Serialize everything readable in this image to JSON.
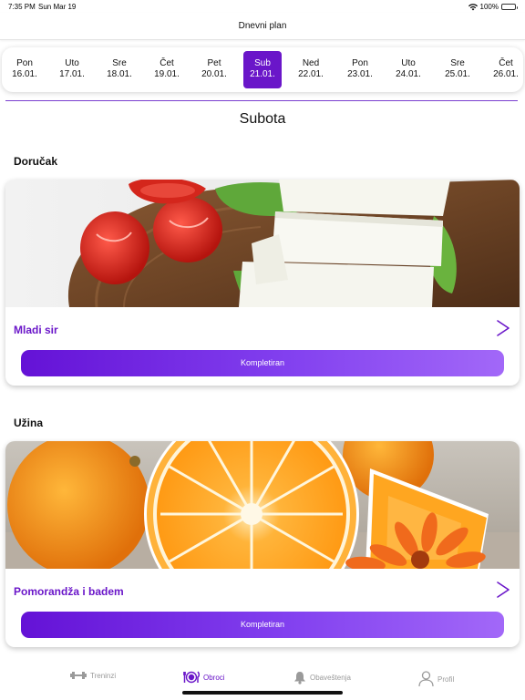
{
  "status": {
    "time": "7:35 PM",
    "date": "Sun Mar 19",
    "battery": "100%",
    "battery_level": 1.0
  },
  "nav": {
    "title": "Dnevni plan"
  },
  "days": [
    {
      "name": "Pon",
      "date": "16.01."
    },
    {
      "name": "Uto",
      "date": "17.01."
    },
    {
      "name": "Sre",
      "date": "18.01."
    },
    {
      "name": "Čet",
      "date": "19.01."
    },
    {
      "name": "Pet",
      "date": "20.01."
    },
    {
      "name": "Sub",
      "date": "21.01.",
      "selected": true
    },
    {
      "name": "Ned",
      "date": "22.01."
    },
    {
      "name": "Pon",
      "date": "23.01."
    },
    {
      "name": "Uto",
      "date": "24.01."
    },
    {
      "name": "Sre",
      "date": "25.01."
    },
    {
      "name": "Čet",
      "date": "26.01."
    }
  ],
  "selected_day_title": "Subota",
  "meals": [
    {
      "section": "Doručak",
      "name": "Mladi sir",
      "button": "Kompletiran",
      "image_icon": "cheese-tomato-photo"
    },
    {
      "section": "Užina",
      "name": "Pomorandža i badem",
      "button": "Kompletiran",
      "image_icon": "orange-photo"
    }
  ],
  "tabs": [
    {
      "label": "Treninzi",
      "icon": "dumbbell-icon"
    },
    {
      "label": "Obroci",
      "icon": "plate-cutlery-icon",
      "active": true
    },
    {
      "label": "Obaveštenja",
      "icon": "bell-icon"
    },
    {
      "label": "Profil",
      "icon": "person-icon"
    }
  ],
  "colors": {
    "accent": "#6a16c9",
    "button_start": "#6412d6",
    "button_end": "#a268f8",
    "inactive_tab": "#9a9a9a"
  }
}
